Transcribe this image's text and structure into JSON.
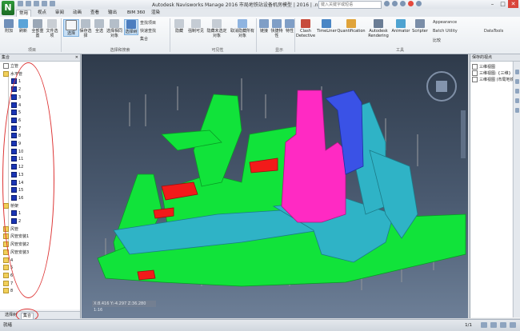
{
  "window": {
    "app_letter": "N",
    "title": "Autodesk Navisworks Manage 2016   市局地铁站设备机房模型 | 2016 | .nwd",
    "search_placeholder": "键入关键字或短语",
    "buttons": [
      "–",
      "□",
      "✕"
    ]
  },
  "tabs": [
    "常用",
    "视点",
    "审阅",
    "动画",
    "查看",
    "输出",
    "BIM 360",
    "渲染"
  ],
  "ribbon": {
    "items": [
      {
        "id": "attach",
        "label": "附加"
      },
      {
        "id": "refresh",
        "label": "刷新"
      },
      {
        "id": "reset-all",
        "label": "全部重置"
      },
      {
        "id": "file-options",
        "label": "文件选项"
      },
      {
        "id": "select",
        "label": "选择"
      },
      {
        "id": "save-selection",
        "label": "保存选择"
      },
      {
        "id": "select-all",
        "label": "全选"
      },
      {
        "id": "select-same",
        "label": "选择相同对象"
      },
      {
        "id": "selection-tree",
        "label": "选择树"
      },
      {
        "id": "hide",
        "label": "隐藏"
      },
      {
        "id": "require",
        "label": "强制可见"
      },
      {
        "id": "hide-unselected",
        "label": "隐藏未选定对象"
      },
      {
        "id": "unhide-all",
        "label": "取消隐藏所有对象"
      },
      {
        "id": "links",
        "label": "链接"
      },
      {
        "id": "quick-props",
        "label": "快捷特性"
      },
      {
        "id": "properties",
        "label": "特性"
      },
      {
        "id": "clash",
        "label": "Clash Detective"
      },
      {
        "id": "timeliner",
        "label": "TimeLiner"
      },
      {
        "id": "quantification",
        "label": "Quantification"
      },
      {
        "id": "rendering",
        "label": "Autodesk Rendering"
      },
      {
        "id": "animator",
        "label": "Animator"
      },
      {
        "id": "scripter",
        "label": "Scripter"
      }
    ],
    "small": {
      "find_items": "查找项目",
      "quick_find": "快速查找",
      "set": "集合",
      "appearance": "Appearance",
      "batch_utility": "Batch Utility",
      "compare": "比较",
      "datatools": "DataTools"
    },
    "groups": [
      "项目",
      "选择和搜索",
      "可见性",
      "显示",
      "工具"
    ]
  },
  "left_panel": {
    "title": "集合",
    "close": "✕",
    "tree": [
      {
        "label": "立管",
        "kind": "box",
        "indent": 0
      },
      {
        "label": "水平管",
        "kind": "folder",
        "indent": 0
      },
      {
        "label": "1",
        "kind": "blue",
        "indent": 1
      },
      {
        "label": "2",
        "kind": "blue",
        "indent": 1
      },
      {
        "label": "3",
        "kind": "blue",
        "indent": 1
      },
      {
        "label": "4",
        "kind": "blue",
        "indent": 1
      },
      {
        "label": "5",
        "kind": "blue",
        "indent": 1
      },
      {
        "label": "6",
        "kind": "blue",
        "indent": 1
      },
      {
        "label": "7",
        "kind": "blue",
        "indent": 1
      },
      {
        "label": "8",
        "kind": "blue",
        "indent": 1
      },
      {
        "label": "9",
        "kind": "blue",
        "indent": 1
      },
      {
        "label": "10",
        "kind": "blue",
        "indent": 1
      },
      {
        "label": "11",
        "kind": "blue",
        "indent": 1
      },
      {
        "label": "12",
        "kind": "blue",
        "indent": 1
      },
      {
        "label": "13",
        "kind": "blue",
        "indent": 1
      },
      {
        "label": "14",
        "kind": "blue",
        "indent": 1
      },
      {
        "label": "15",
        "kind": "blue",
        "indent": 1
      },
      {
        "label": "16",
        "kind": "blue",
        "indent": 1
      },
      {
        "label": "桥架",
        "kind": "folder",
        "indent": 0
      },
      {
        "label": "1",
        "kind": "blue",
        "indent": 1
      },
      {
        "label": "2",
        "kind": "blue",
        "indent": 1
      },
      {
        "label": "风管",
        "kind": "folder",
        "indent": 0
      },
      {
        "label": "风管安装1",
        "kind": "folder",
        "indent": 0
      },
      {
        "label": "风管安装2",
        "kind": "folder",
        "indent": 0
      },
      {
        "label": "风管安装3",
        "kind": "folder",
        "indent": 0
      },
      {
        "label": "4",
        "kind": "folder",
        "indent": 0
      },
      {
        "label": "5",
        "kind": "folder",
        "indent": 0
      },
      {
        "label": "6",
        "kind": "folder",
        "indent": 0
      },
      {
        "label": "7",
        "kind": "folder",
        "indent": 0
      },
      {
        "label": "8",
        "kind": "folder",
        "indent": 0
      }
    ],
    "bottom_tabs": [
      "选择树",
      "集合"
    ]
  },
  "viewport": {
    "coords": "X:8.416 Y:-4.297 Z:36.280 1:16"
  },
  "right_panel": {
    "title": "保存的视点",
    "items": [
      "三维视图",
      "三维视图: {三维}",
      "三维视图 (市局地铁站)"
    ]
  },
  "statusbar": {
    "ready": "就绪",
    "page": "1/1"
  },
  "colors": {
    "pipe_green": "#11e33a",
    "duct_cyan": "#2fb3c6",
    "duct_pink": "#ff2ac3",
    "duct_blue": "#3a52e6",
    "tray_red": "#f21a1a",
    "annotation": "#dd3333"
  }
}
